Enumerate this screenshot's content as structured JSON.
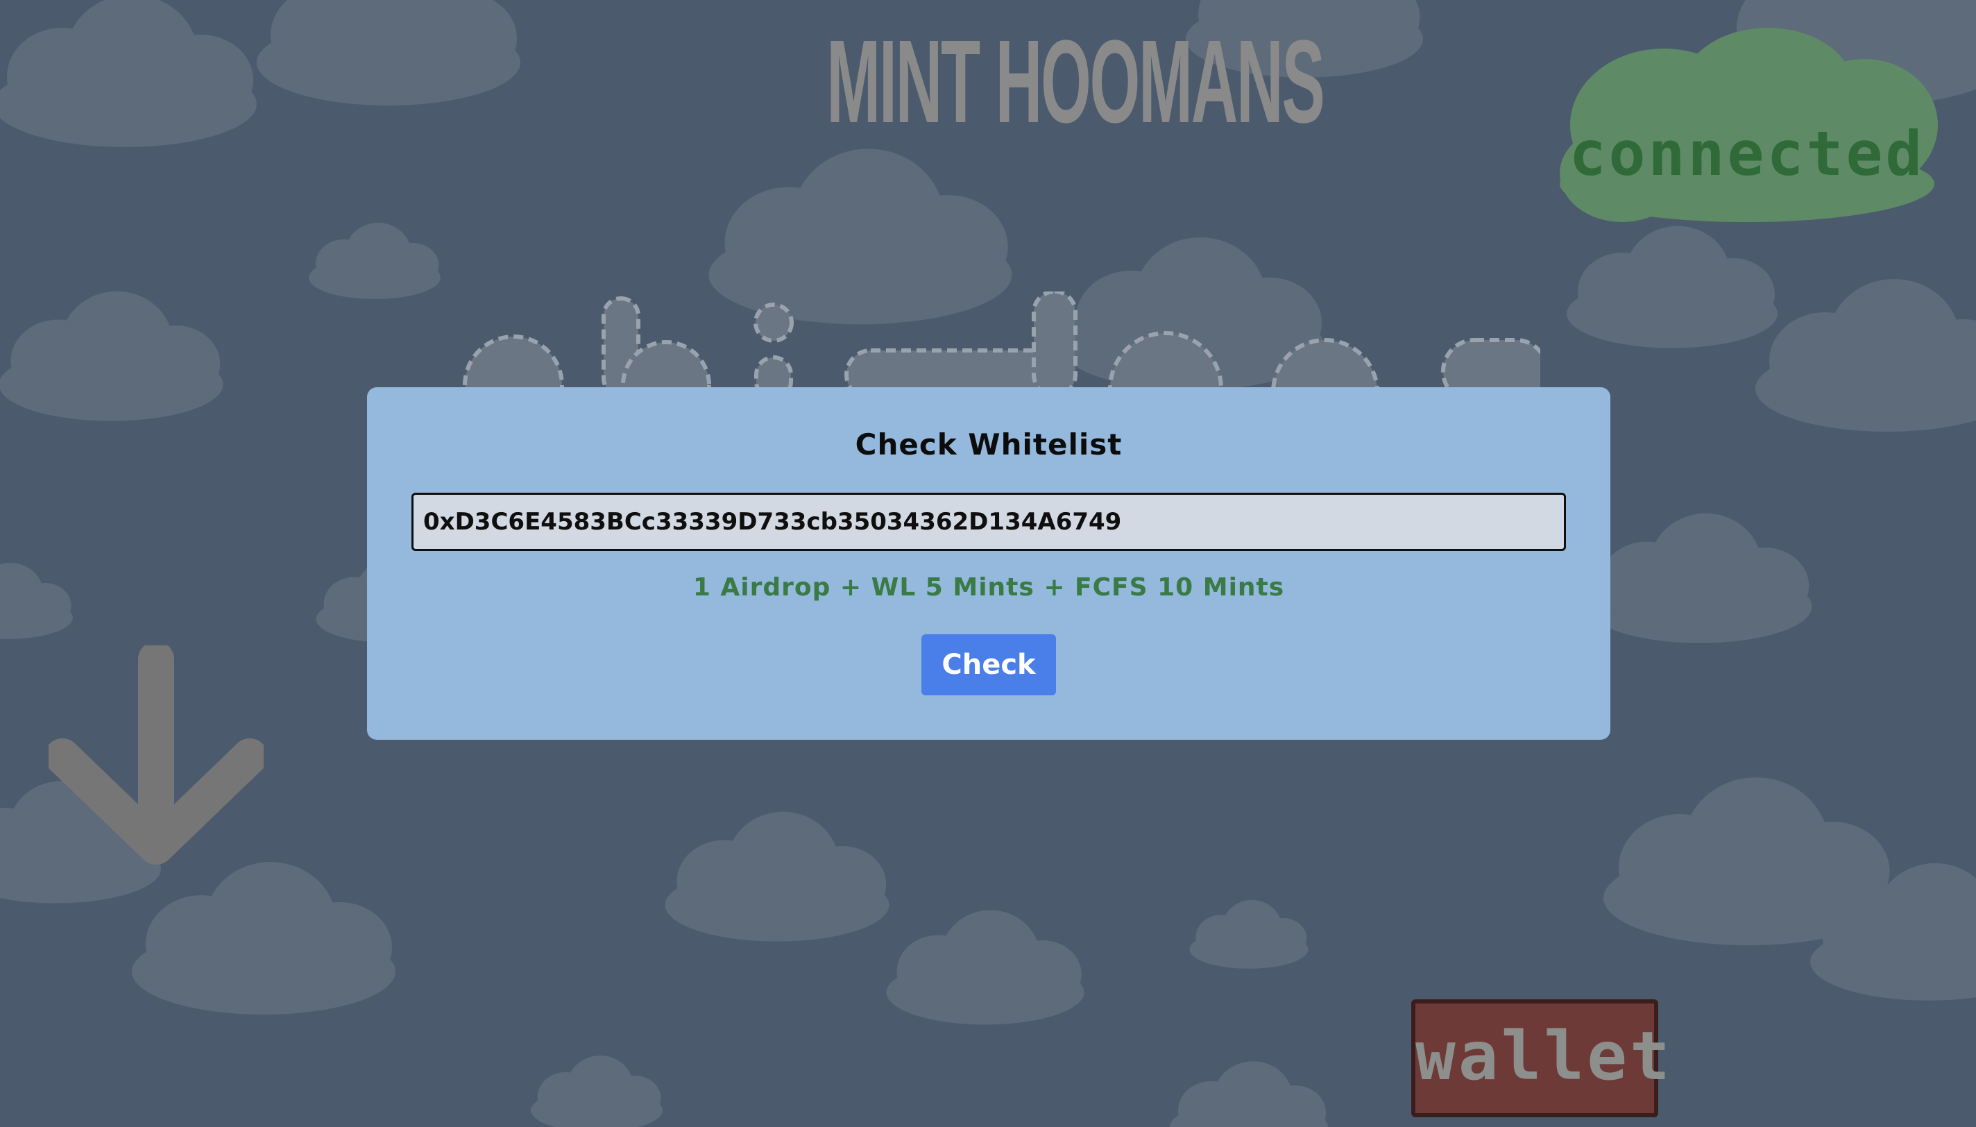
{
  "header": {
    "title": "MINT HOOMANS"
  },
  "status": {
    "connected_label": "connected"
  },
  "wallet": {
    "label": "wallet"
  },
  "modal": {
    "title": "Check Whitelist",
    "address_value": "0xD3C6E4583BCc33339D733cb35034362D134A6749",
    "result": "1 Airdrop + WL 5 Mints + FCFS 10 Mints",
    "check_label": "Check"
  },
  "colors": {
    "background": "#4b5b6d",
    "modal": "#94b9dc",
    "accent_button": "#4a7ee8",
    "result_green": "#3a7a44",
    "connected_green": "#5e8a65",
    "wallet_red": "#6e3a37"
  },
  "icons": {
    "scroll_indicator": "arrow-down-icon"
  }
}
